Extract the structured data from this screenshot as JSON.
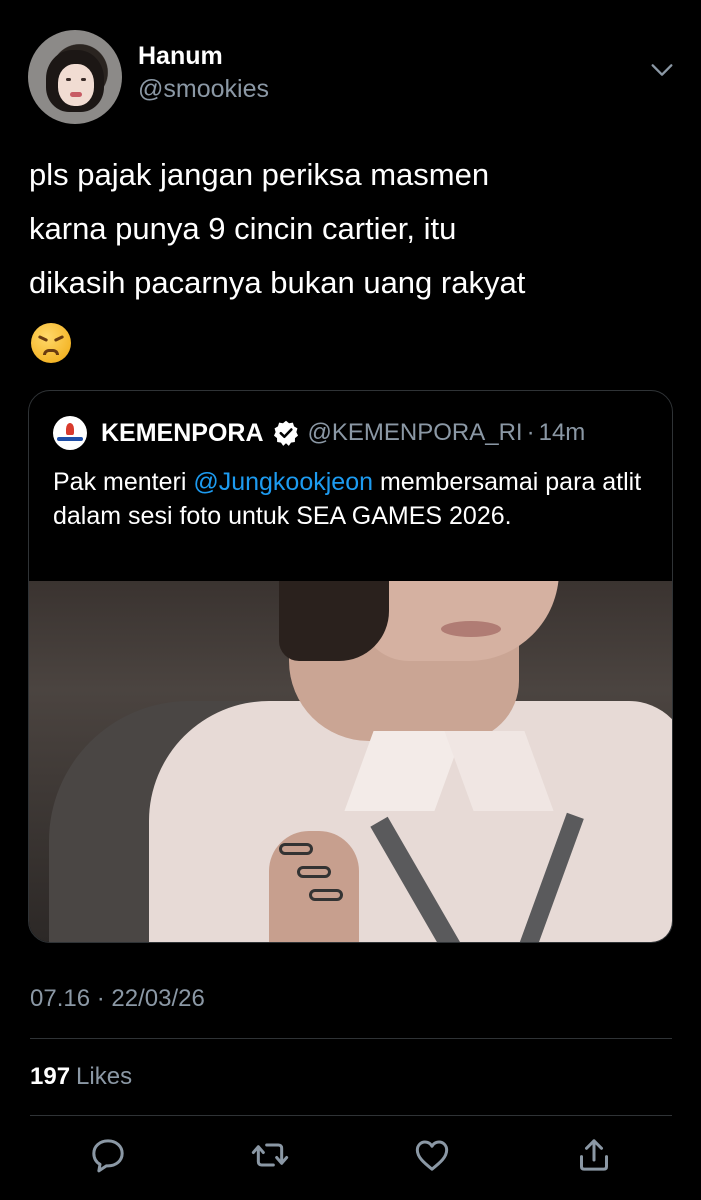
{
  "author": {
    "name": "Hanum",
    "handle": "@smookies"
  },
  "tweet": {
    "line1": "pls pajak jangan periksa masmen",
    "line2": "karna punya 9 cincin cartier, itu",
    "line3": "dikasih pacarnya bukan uang rakyat",
    "emoji": "persevering-face"
  },
  "quoted": {
    "name": "KEMENPORA",
    "handle": "@KEMENPORA_RI",
    "separator": "·",
    "time": "14m",
    "text_before": "Pak menteri ",
    "mention": "@Jungkookjeon",
    "text_after": " membersamai para atlit dalam sesi foto untuk SEA GAMES 2026."
  },
  "meta": {
    "time": "07.16",
    "separator": "·",
    "date": "22/03/26"
  },
  "stats": {
    "likes_count": "197",
    "likes_label": "Likes"
  },
  "colors": {
    "background": "#000000",
    "mention": "#1d9bf0",
    "verified": "#ffffff",
    "secondary_text": "#8b98a5"
  }
}
